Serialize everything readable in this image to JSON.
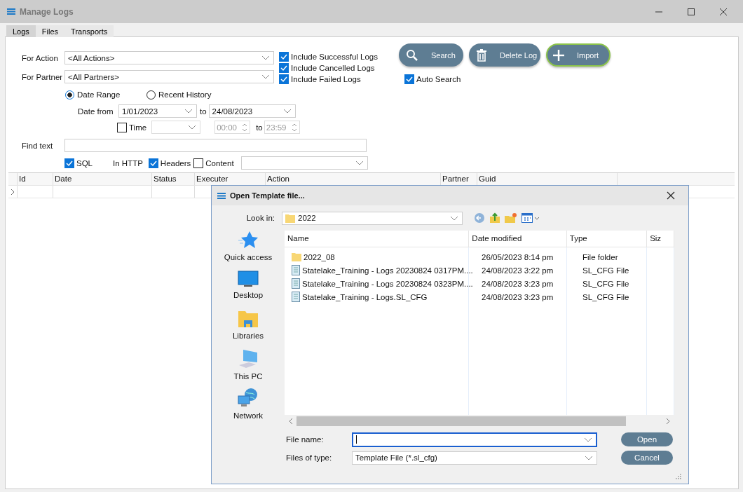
{
  "window": {
    "title": "Manage Logs"
  },
  "tabs": [
    {
      "label": "Logs",
      "selected": true
    },
    {
      "label": "Files",
      "selected": false
    },
    {
      "label": "Transports",
      "selected": false
    }
  ],
  "filters": {
    "for_action": {
      "label": "For Action",
      "value": "<All Actions>"
    },
    "for_partner": {
      "label": "For Partner",
      "value": "<All Partners>"
    },
    "includes": [
      {
        "label": "Include Successful Logs",
        "checked": true
      },
      {
        "label": "Include Cancelled Logs",
        "checked": true
      },
      {
        "label": "Include Failed Logs",
        "checked": true
      }
    ],
    "range_options": [
      {
        "label": "Date Range",
        "selected": true
      },
      {
        "label": "Recent History",
        "selected": false
      }
    ],
    "date_from": {
      "label": "Date from",
      "value": "1/01/2023"
    },
    "date_to": {
      "label": "to",
      "value": "24/08/2023"
    },
    "time": {
      "label": "Time",
      "checked": false
    },
    "time_from": {
      "value": "00:00"
    },
    "time_to": {
      "label": "to",
      "value": "23:59"
    },
    "find_text": {
      "label": "Find text"
    },
    "search_in": [
      {
        "kind": "checkbox",
        "label": "SQL",
        "checked": true
      },
      {
        "kind": "text",
        "label": "In HTTP"
      },
      {
        "kind": "checkbox",
        "label": "Headers",
        "checked": true
      },
      {
        "kind": "checkbox",
        "label": "Content",
        "checked": false
      }
    ]
  },
  "actions": [
    {
      "kind": "search",
      "label": "Search"
    },
    {
      "kind": "delete",
      "label": "Delete Log"
    },
    {
      "kind": "import",
      "label": "Import"
    }
  ],
  "auto_search": {
    "label": "Auto Search",
    "checked": true
  },
  "grid": {
    "columns": [
      "Id",
      "Date",
      "Status",
      "Executer",
      "Action",
      "Partner",
      "Guid"
    ]
  },
  "dialog": {
    "title": "Open Template file...",
    "look_in": {
      "label": "Look in:",
      "value": "2022"
    },
    "places": [
      {
        "kind": "quick",
        "label": "Quick access"
      },
      {
        "kind": "desktop",
        "label": "Desktop"
      },
      {
        "kind": "libraries",
        "label": "Libraries"
      },
      {
        "kind": "pc",
        "label": "This PC"
      },
      {
        "kind": "network",
        "label": "Network"
      }
    ],
    "columns": [
      "Name",
      "Date modified",
      "Type",
      "Siz"
    ],
    "files": [
      {
        "kind": "folder",
        "name": "2022_08",
        "date": "26/05/2023 8:14 pm",
        "type": "File folder"
      },
      {
        "kind": "file",
        "name": "Statelake_Training - Logs 20230824 0317PM....",
        "date": "24/08/2023 3:22 pm",
        "type": "SL_CFG File"
      },
      {
        "kind": "file",
        "name": "Statelake_Training - Logs 20230824 0323PM....",
        "date": "24/08/2023 3:23 pm",
        "type": "SL_CFG File"
      },
      {
        "kind": "file",
        "name": "Statelake_Training - Logs.SL_CFG",
        "date": "24/08/2023 3:23 pm",
        "type": "SL_CFG File"
      }
    ],
    "file_name": {
      "label": "File name:"
    },
    "file_type": {
      "label": "Files of type:",
      "value": "Template File (*.sl_cfg)"
    },
    "buttons": [
      "Open",
      "Cancel"
    ]
  }
}
